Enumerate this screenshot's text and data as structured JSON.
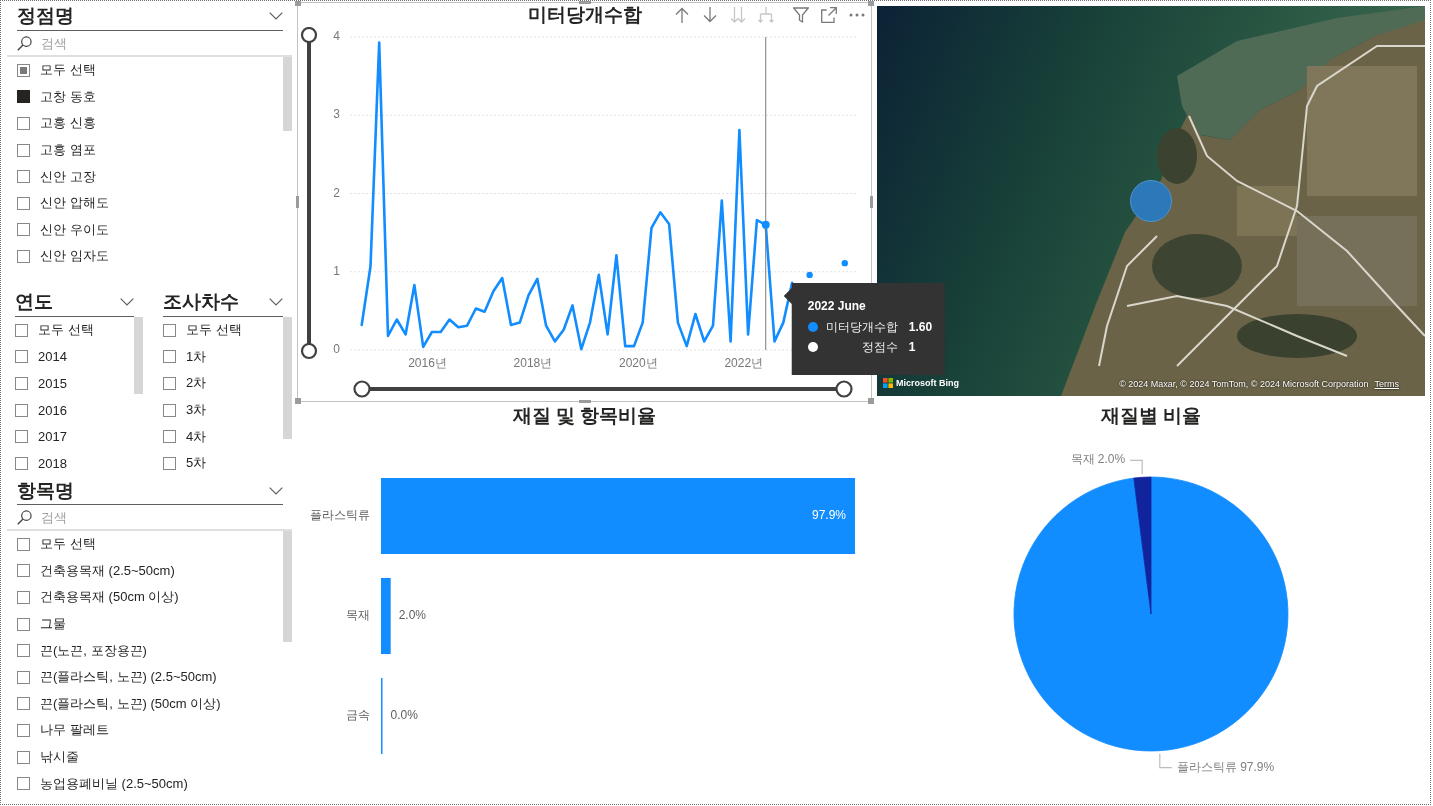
{
  "slicers": [
    {
      "title": "정점명",
      "search": {
        "placeholder": "검색"
      },
      "select_all": {
        "label": "모두 선택",
        "checked": false,
        "partial": true
      },
      "items": [
        {
          "label": "고창 동호",
          "checked": true
        },
        {
          "label": "고흥 신흥",
          "checked": false
        },
        {
          "label": "고흥 염포",
          "checked": false
        },
        {
          "label": "신안 고장",
          "checked": false
        },
        {
          "label": "신안 압해도",
          "checked": false
        },
        {
          "label": "신안 우이도",
          "checked": false
        },
        {
          "label": "신안 임자도",
          "checked": false
        }
      ]
    },
    {
      "title": "연도",
      "select_all": {
        "label": "모두 선택",
        "checked": false,
        "partial": false
      },
      "items": [
        {
          "label": "2014",
          "checked": false
        },
        {
          "label": "2015",
          "checked": false
        },
        {
          "label": "2016",
          "checked": false
        },
        {
          "label": "2017",
          "checked": false
        },
        {
          "label": "2018",
          "checked": false
        }
      ]
    },
    {
      "title": "조사차수",
      "select_all": {
        "label": "모두 선택",
        "checked": false,
        "partial": false
      },
      "items": [
        {
          "label": "1차",
          "checked": false
        },
        {
          "label": "2차",
          "checked": false
        },
        {
          "label": "3차",
          "checked": false
        },
        {
          "label": "4차",
          "checked": false
        },
        {
          "label": "5차",
          "checked": false
        }
      ]
    },
    {
      "title": "항목명",
      "search": {
        "placeholder": "검색"
      },
      "select_all": {
        "label": "모두 선택",
        "checked": false,
        "partial": false
      },
      "items": [
        {
          "label": "건축용목재 (2.5~50cm)",
          "checked": false
        },
        {
          "label": "건축용목재 (50cm 이상)",
          "checked": false
        },
        {
          "label": "그물",
          "checked": false
        },
        {
          "label": "끈(노끈, 포장용끈)",
          "checked": false
        },
        {
          "label": "끈(플라스틱, 노끈) (2.5~50cm)",
          "checked": false
        },
        {
          "label": "끈(플라스틱, 노끈) (50cm 이상)",
          "checked": false
        },
        {
          "label": "나무 팔레트",
          "checked": false
        },
        {
          "label": "낚시줄",
          "checked": false
        },
        {
          "label": "농업용폐비닐 (2.5~50cm)",
          "checked": false
        }
      ]
    }
  ],
  "line_chart": {
    "toolbar": [
      {
        "kind": "up",
        "disabled": false
      },
      {
        "kind": "down",
        "disabled": false
      },
      {
        "kind": "drill",
        "disabled": true
      },
      {
        "kind": "expand",
        "disabled": true
      },
      {
        "kind": "filter",
        "disabled": false
      },
      {
        "kind": "focus",
        "disabled": false
      },
      {
        "kind": "more",
        "disabled": false
      }
    ],
    "chart_data": {
      "type": "line",
      "title": "미터당개수합",
      "x": [
        2014.75,
        2014.917,
        2015.083,
        2015.25,
        2015.417,
        2015.583,
        2015.75,
        2015.917,
        2016.083,
        2016.25,
        2016.417,
        2016.583,
        2016.75,
        2016.917,
        2017.083,
        2017.25,
        2017.417,
        2017.583,
        2017.75,
        2017.917,
        2018.083,
        2018.25,
        2018.417,
        2018.583,
        2018.75,
        2018.917,
        2019.083,
        2019.25,
        2019.417,
        2019.583,
        2019.75,
        2019.917,
        2020.083,
        2020.25,
        2020.417,
        2020.583,
        2020.75,
        2020.917,
        2021.083,
        2021.25,
        2021.417,
        2021.583,
        2021.75,
        2021.917,
        2022.083,
        2022.25,
        2022.417,
        2022.583,
        2022.75,
        2022.917,
        2023.083,
        2023.25,
        2023.417,
        2023.583,
        2023.75,
        2023.917
      ],
      "values": [
        0.32,
        1.07,
        3.93,
        0.18,
        0.39,
        0.2,
        0.83,
        0.04,
        0.23,
        0.23,
        0.39,
        0.29,
        0.31,
        0.53,
        0.49,
        0.75,
        0.92,
        0.32,
        0.35,
        0.7,
        0.91,
        0.31,
        0.11,
        0.26,
        0.57,
        0.01,
        0.35,
        0.96,
        0.2,
        1.21,
        0.05,
        0.05,
        0.35,
        1.56,
        1.76,
        1.61,
        0.35,
        0.05,
        0.46,
        0.11,
        0.31,
        1.91,
        0.11,
        2.81,
        0.2,
        1.66,
        1.6,
        0.11,
        0.35,
        0.86,
        null,
        0.96,
        null,
        null,
        null,
        1.11
      ],
      "xlim": [
        2014.54,
        2024.13
      ],
      "ylim": [
        0,
        4
      ],
      "xticks": [
        {
          "value": 2016,
          "label": "2016년"
        },
        {
          "value": 2018,
          "label": "2018년"
        },
        {
          "value": 2020,
          "label": "2020년"
        },
        {
          "value": 2022,
          "label": "2022년"
        }
      ],
      "yticks": [
        0,
        1,
        2,
        3,
        4
      ],
      "grid": true,
      "ref_lines": [
        {
          "axis": "x",
          "value": 2022.417
        }
      ]
    },
    "tooltip": {
      "title": "2022 June",
      "rows": [
        {
          "label": "미터당개수합",
          "value": "1.60",
          "color": "#118dff"
        },
        {
          "label": "정점수",
          "value": "1",
          "color": "#ffffff"
        }
      ]
    }
  },
  "map": {
    "logo": "Microsoft Bing",
    "attribution": "© 2024 Maxar, © 2024 TomTom, © 2024 Microsoft Corporation",
    "terms": "Terms"
  },
  "bar_chart": {
    "chart_data": {
      "type": "bar",
      "orientation": "horizontal",
      "title": "재질 및 항목비율",
      "categories": [
        "플라스틱류",
        "목재",
        "금속"
      ],
      "values": [
        97.9,
        2.0,
        0.04
      ],
      "value_labels": [
        "97.9%",
        "2.0%",
        "0.0%"
      ]
    }
  },
  "pie_chart": {
    "chart_data": {
      "type": "pie",
      "title": "재질별 비율",
      "categories": [
        "플라스틱류",
        "목재"
      ],
      "values": [
        97.9,
        2.0
      ],
      "colors": [
        "#118dff",
        "#12239e"
      ],
      "value_labels": [
        "97.9%",
        "2.0%"
      ]
    }
  }
}
